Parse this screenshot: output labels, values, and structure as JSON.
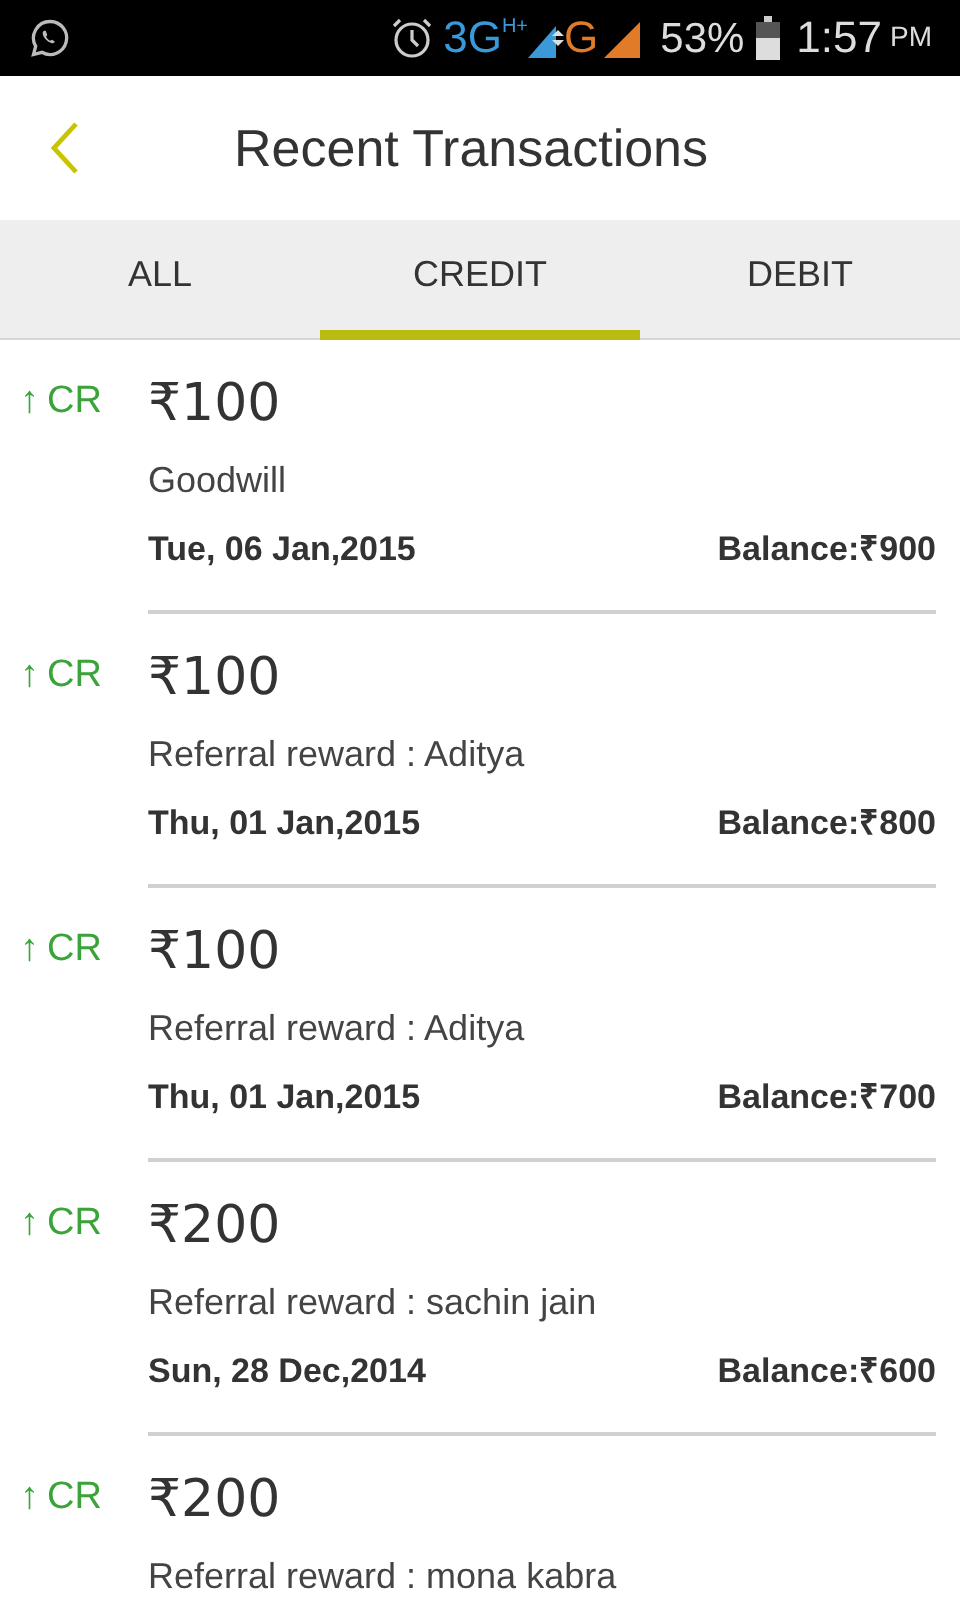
{
  "status_bar": {
    "network": "3G",
    "network_sup": "H+",
    "network2": "G",
    "battery": "53%",
    "time": "1:57",
    "ampm": "PM"
  },
  "header": {
    "title": "Recent Transactions"
  },
  "tabs": [
    {
      "label": "ALL",
      "selected": false
    },
    {
      "label": "CREDIT",
      "selected": true
    },
    {
      "label": "DEBIT",
      "selected": false
    }
  ],
  "transactions": [
    {
      "kind": "credit",
      "arrow": "↑",
      "type": "CR",
      "amount": "₹100",
      "description": "Goodwill",
      "date": "Tue, 06 Jan,2015",
      "balance": "Balance:₹900"
    },
    {
      "kind": "credit",
      "arrow": "↑",
      "type": "CR",
      "amount": "₹100",
      "description": "Referral reward : Aditya",
      "date": "Thu, 01 Jan,2015",
      "balance": "Balance:₹800"
    },
    {
      "kind": "credit",
      "arrow": "↑",
      "type": "CR",
      "amount": "₹100",
      "description": "Referral reward : Aditya",
      "date": "Thu, 01 Jan,2015",
      "balance": "Balance:₹700"
    },
    {
      "kind": "credit",
      "arrow": "↑",
      "type": "CR",
      "amount": "₹200",
      "description": "Referral reward : sachin jain",
      "date": "Sun, 28 Dec,2014",
      "balance": "Balance:₹600"
    },
    {
      "kind": "credit",
      "arrow": "↑",
      "type": "CR",
      "amount": "₹200",
      "description": "Referral reward : mona kabra"
    }
  ]
}
